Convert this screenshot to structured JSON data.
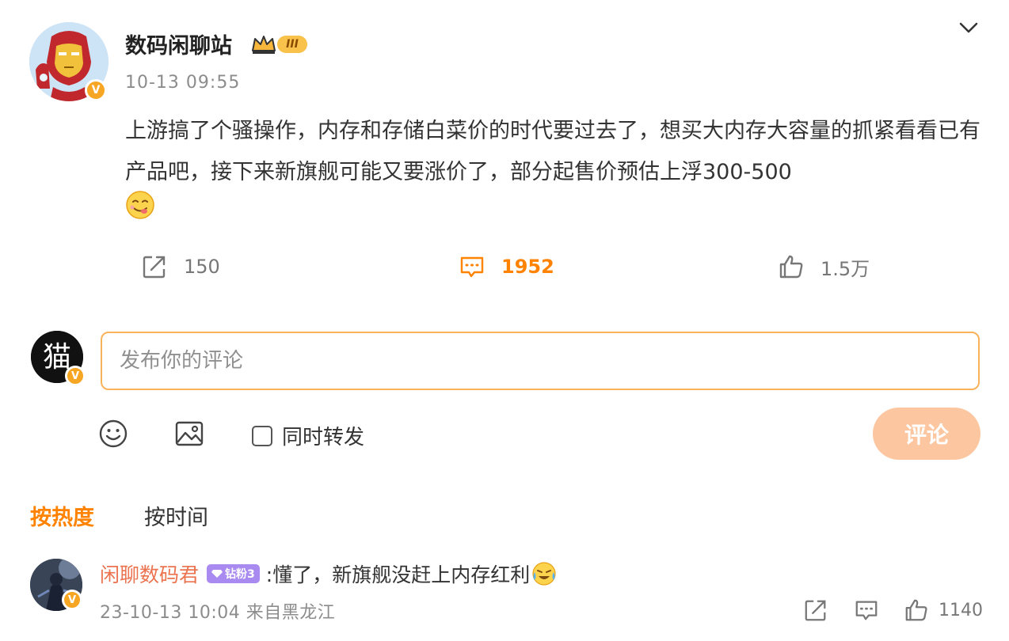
{
  "post": {
    "author": "数码闲聊站",
    "level_badge": "III",
    "verified_mark": "V",
    "time": "10-13 09:55",
    "text": "上游搞了个骚操作，内存和存储白菜价的时代要过去了，想买大内存大容量的抓紧看看已有产品吧，接下来新旗舰可能又要涨价了，部分起售价预估上浮300-500",
    "emoji": "yummy-face-emoji",
    "menu_icon": "chevron-down-icon"
  },
  "actions": {
    "repost_count": "150",
    "comment_count": "1952",
    "like_count": "1.5万"
  },
  "composer": {
    "placeholder": "发布你的评论",
    "avatar_glyph": "猫",
    "verified_mark": "V",
    "forward_label": "同时转发",
    "submit_label": "评论"
  },
  "sort": {
    "hot_label": "按热度",
    "time_label": "按时间"
  },
  "comments": [
    {
      "user": "闲聊数码君",
      "badge": "钻粉3",
      "text": ":懂了，新旗舰没赶上内存红利",
      "verified_mark": "V",
      "meta": "23-10-13 10:04 来自黑龙江",
      "like_count": "1140"
    }
  ],
  "colors": {
    "accent": "#ff8200",
    "username_comment": "#eb7350",
    "input_border": "#f8b35a",
    "submit_disabled": "#fcc7a0",
    "muted": "#8c8c8c",
    "fan_badge": "#a98af0"
  }
}
